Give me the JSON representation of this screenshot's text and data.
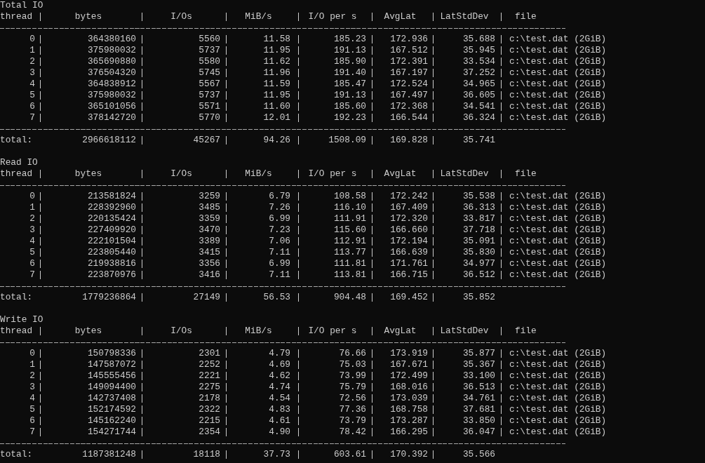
{
  "sections": [
    {
      "title": "Total IO",
      "columns": [
        "thread",
        "bytes",
        "I/Os",
        "MiB/s",
        "I/O per s",
        "AvgLat",
        "LatStdDev",
        "file"
      ],
      "rows": [
        [
          "0",
          "364380160",
          "5560",
          "11.58",
          "185.23",
          "172.936",
          "35.688",
          "c:\\test.dat (2GiB)"
        ],
        [
          "1",
          "375980032",
          "5737",
          "11.95",
          "191.13",
          "167.512",
          "35.945",
          "c:\\test.dat (2GiB)"
        ],
        [
          "2",
          "365690880",
          "5580",
          "11.62",
          "185.90",
          "172.391",
          "33.534",
          "c:\\test.dat (2GiB)"
        ],
        [
          "3",
          "376504320",
          "5745",
          "11.96",
          "191.40",
          "167.197",
          "37.252",
          "c:\\test.dat (2GiB)"
        ],
        [
          "4",
          "364838912",
          "5567",
          "11.59",
          "185.47",
          "172.524",
          "34.965",
          "c:\\test.dat (2GiB)"
        ],
        [
          "5",
          "375980032",
          "5737",
          "11.95",
          "191.13",
          "167.497",
          "36.605",
          "c:\\test.dat (2GiB)"
        ],
        [
          "6",
          "365101056",
          "5571",
          "11.60",
          "185.60",
          "172.368",
          "34.541",
          "c:\\test.dat (2GiB)"
        ],
        [
          "7",
          "378142720",
          "5770",
          "12.01",
          "192.23",
          "166.544",
          "36.324",
          "c:\\test.dat (2GiB)"
        ]
      ],
      "total": [
        "total:",
        "2966618112",
        "45267",
        "94.26",
        "1508.09",
        "169.828",
        "35.741"
      ]
    },
    {
      "title": "Read IO",
      "columns": [
        "thread",
        "bytes",
        "I/Os",
        "MiB/s",
        "I/O per s",
        "AvgLat",
        "LatStdDev",
        "file"
      ],
      "rows": [
        [
          "0",
          "213581824",
          "3259",
          "6.79",
          "108.58",
          "172.242",
          "35.538",
          "c:\\test.dat (2GiB)"
        ],
        [
          "1",
          "228392960",
          "3485",
          "7.26",
          "116.10",
          "167.409",
          "36.313",
          "c:\\test.dat (2GiB)"
        ],
        [
          "2",
          "220135424",
          "3359",
          "6.99",
          "111.91",
          "172.320",
          "33.817",
          "c:\\test.dat (2GiB)"
        ],
        [
          "3",
          "227409920",
          "3470",
          "7.23",
          "115.60",
          "166.660",
          "37.718",
          "c:\\test.dat (2GiB)"
        ],
        [
          "4",
          "222101504",
          "3389",
          "7.06",
          "112.91",
          "172.194",
          "35.091",
          "c:\\test.dat (2GiB)"
        ],
        [
          "5",
          "223805440",
          "3415",
          "7.11",
          "113.77",
          "166.639",
          "35.830",
          "c:\\test.dat (2GiB)"
        ],
        [
          "6",
          "219938816",
          "3356",
          "6.99",
          "111.81",
          "171.761",
          "34.977",
          "c:\\test.dat (2GiB)"
        ],
        [
          "7",
          "223870976",
          "3416",
          "7.11",
          "113.81",
          "166.715",
          "36.512",
          "c:\\test.dat (2GiB)"
        ]
      ],
      "total": [
        "total:",
        "1779236864",
        "27149",
        "56.53",
        "904.48",
        "169.452",
        "35.852"
      ]
    },
    {
      "title": "Write IO",
      "columns": [
        "thread",
        "bytes",
        "I/Os",
        "MiB/s",
        "I/O per s",
        "AvgLat",
        "LatStdDev",
        "file"
      ],
      "rows": [
        [
          "0",
          "150798336",
          "2301",
          "4.79",
          "76.66",
          "173.919",
          "35.877",
          "c:\\test.dat (2GiB)"
        ],
        [
          "1",
          "147587072",
          "2252",
          "4.69",
          "75.03",
          "167.671",
          "35.367",
          "c:\\test.dat (2GiB)"
        ],
        [
          "2",
          "145555456",
          "2221",
          "4.62",
          "73.99",
          "172.499",
          "33.100",
          "c:\\test.dat (2GiB)"
        ],
        [
          "3",
          "149094400",
          "2275",
          "4.74",
          "75.79",
          "168.016",
          "36.513",
          "c:\\test.dat (2GiB)"
        ],
        [
          "4",
          "142737408",
          "2178",
          "4.54",
          "72.56",
          "173.039",
          "34.761",
          "c:\\test.dat (2GiB)"
        ],
        [
          "5",
          "152174592",
          "2322",
          "4.83",
          "77.36",
          "168.758",
          "37.681",
          "c:\\test.dat (2GiB)"
        ],
        [
          "6",
          "145162240",
          "2215",
          "4.61",
          "73.79",
          "173.287",
          "33.850",
          "c:\\test.dat (2GiB)"
        ],
        [
          "7",
          "154271744",
          "2354",
          "4.90",
          "78.42",
          "166.295",
          "36.047",
          "c:\\test.dat (2GiB)"
        ]
      ],
      "total": [
        "total:",
        "1187381248",
        "18118",
        "37.73",
        "603.61",
        "170.392",
        "35.566"
      ]
    }
  ]
}
